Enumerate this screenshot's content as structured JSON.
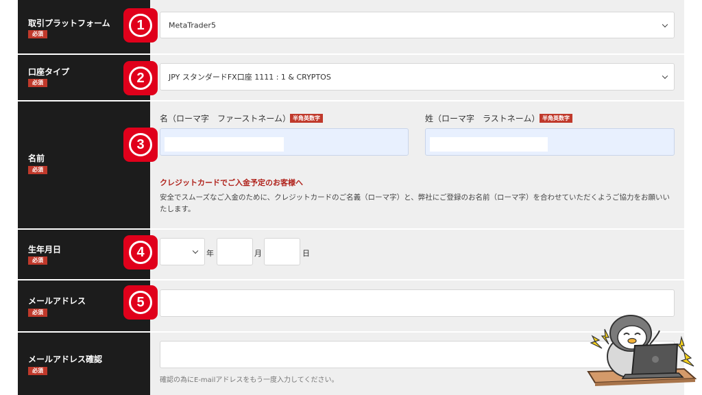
{
  "required_badge": "必須",
  "alnum_badge": "半角英数字",
  "steps": [
    "1",
    "2",
    "3",
    "4",
    "5"
  ],
  "platform": {
    "label": "取引プラットフォーム",
    "selected": "MetaTrader5"
  },
  "account_type": {
    "label": "口座タイプ",
    "selected": "JPY スタンダードFX口座 1111 : 1 & CRYPTOS"
  },
  "name": {
    "label": "名前",
    "first_label": "名（ローマ字　ファーストネーム）",
    "last_label": "姓（ローマ字　ラストネーム）",
    "notice_title": "クレジットカードでご入金予定のお客様へ",
    "notice_body": "安全でスムーズなご入金のために、クレジットカードのご名義（ローマ字）と、弊社にご登録のお名前（ローマ字）を合わせていただくようご協力をお願いいたします。"
  },
  "birthday": {
    "label": "生年月日",
    "year_unit": "年",
    "month_unit": "月",
    "day_unit": "日"
  },
  "email": {
    "label": "メールアドレス"
  },
  "email_confirm": {
    "label": "メールアドレス確認",
    "hint": "確認の為にE-mailアドレスをもう一度入力してください。"
  },
  "colors": {
    "label_bg": "#1c1c1c",
    "content_bg": "#efefef",
    "accent_red": "#e0001b",
    "badge_red": "#c0392b"
  }
}
